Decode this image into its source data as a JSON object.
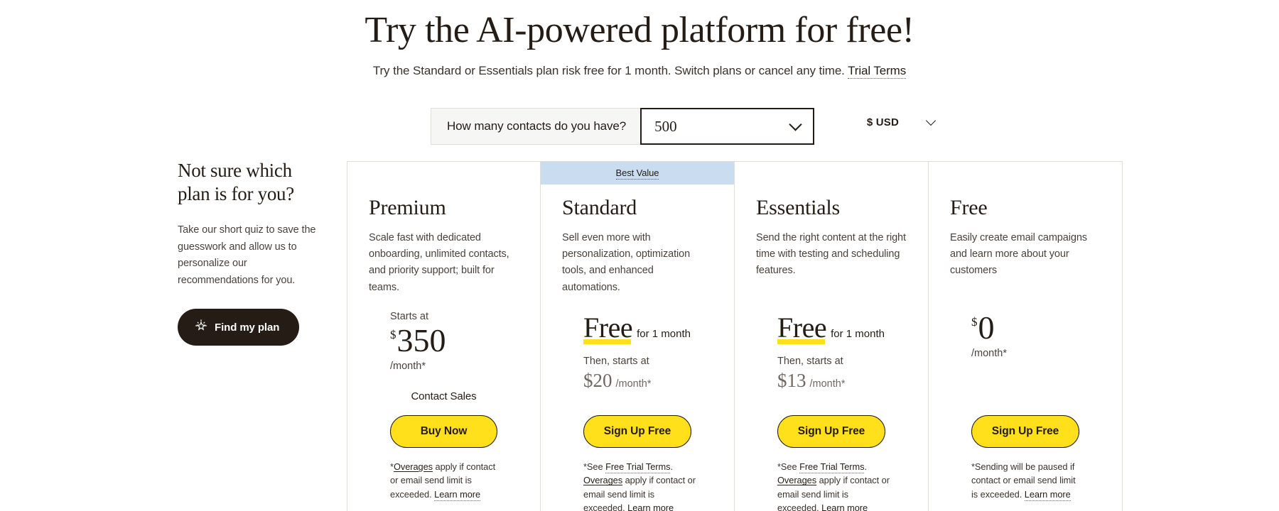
{
  "hero": {
    "title_highlight": "Try",
    "title_rest": " the AI-powered platform for free!",
    "subtitle_text": "Try the Standard or Essentials plan risk free for 1 month. Switch plans or cancel any time. ",
    "subtitle_link": "Trial Terms"
  },
  "controls": {
    "contacts_label": "How many contacts do you have?",
    "contacts_value": "500",
    "contacts_icon": "chevron-down-icon",
    "currency_label": "$ USD",
    "currency_icon": "chevron-down-icon"
  },
  "promo": {
    "title": "Not sure which plan is for you?",
    "body": "Take our short quiz to save the guesswork and allow us to personalize our recommendations for you.",
    "button_label": "Find my plan",
    "button_icon": "sparkle-icon"
  },
  "plans": [
    {
      "name": "Premium",
      "description": "Scale fast with dedicated onboarding, unlimited contacts, and priority support; built for teams.",
      "banner": null,
      "starts_at": "Starts at",
      "currency_symbol": "$",
      "price": "350",
      "per_month": "/month*",
      "secondary_action": "Contact Sales",
      "cta_label": "Buy Now",
      "fine_print": {
        "prefix": "*",
        "link1": "Overages",
        "link1_style": "solid",
        "mid": " apply if contact or email send limit is exceeded. ",
        "link2": "Learn more",
        "link2_style": "dotted"
      }
    },
    {
      "name": "Standard",
      "description": "Sell even more with personalization, optimization tools, and enhanced automations.",
      "banner": "Best Value",
      "free_word": "Free",
      "free_suffix": "for 1 month",
      "then_label": "Then, starts at",
      "then_price": "$20",
      "then_per": "/month*",
      "cta_label": "Sign Up Free",
      "fine_print": {
        "prefix": "*See ",
        "link0": "Free Trial Terms",
        "link0_style": "dotted",
        "sep": ". ",
        "link1": "Overages",
        "link1_style": "solid",
        "mid": " apply if contact or email send limit is exceeded. ",
        "link2": "Learn more",
        "link2_style": "dotted"
      }
    },
    {
      "name": "Essentials",
      "description": "Send the right content at the right time with testing and scheduling features.",
      "banner": null,
      "free_word": "Free",
      "free_suffix": "for 1 month",
      "then_label": "Then, starts at",
      "then_price": "$13",
      "then_per": "/month*",
      "cta_label": "Sign Up Free",
      "fine_print": {
        "prefix": "*See ",
        "link0": "Free Trial Terms",
        "link0_style": "dotted",
        "sep": ". ",
        "link1": "Overages",
        "link1_style": "solid",
        "mid": " apply if contact or email send limit is exceeded. ",
        "link2": "Learn more",
        "link2_style": "dotted"
      }
    },
    {
      "name": "Free",
      "description": "Easily create email campaigns and learn more about your customers",
      "banner": null,
      "currency_symbol": "$",
      "price": "0",
      "per_month": "/month*",
      "cta_label": "Sign Up Free",
      "fine_print": {
        "prefix": "*Sending will be paused if contact or email send limit is exceeded. ",
        "link2": "Learn more",
        "link2_style": "dotted"
      }
    }
  ],
  "colors": {
    "brand_yellow": "#ffe01b",
    "ink": "#241c15",
    "banner_blue": "#c9dcf0",
    "divider": "#e0ded9"
  }
}
